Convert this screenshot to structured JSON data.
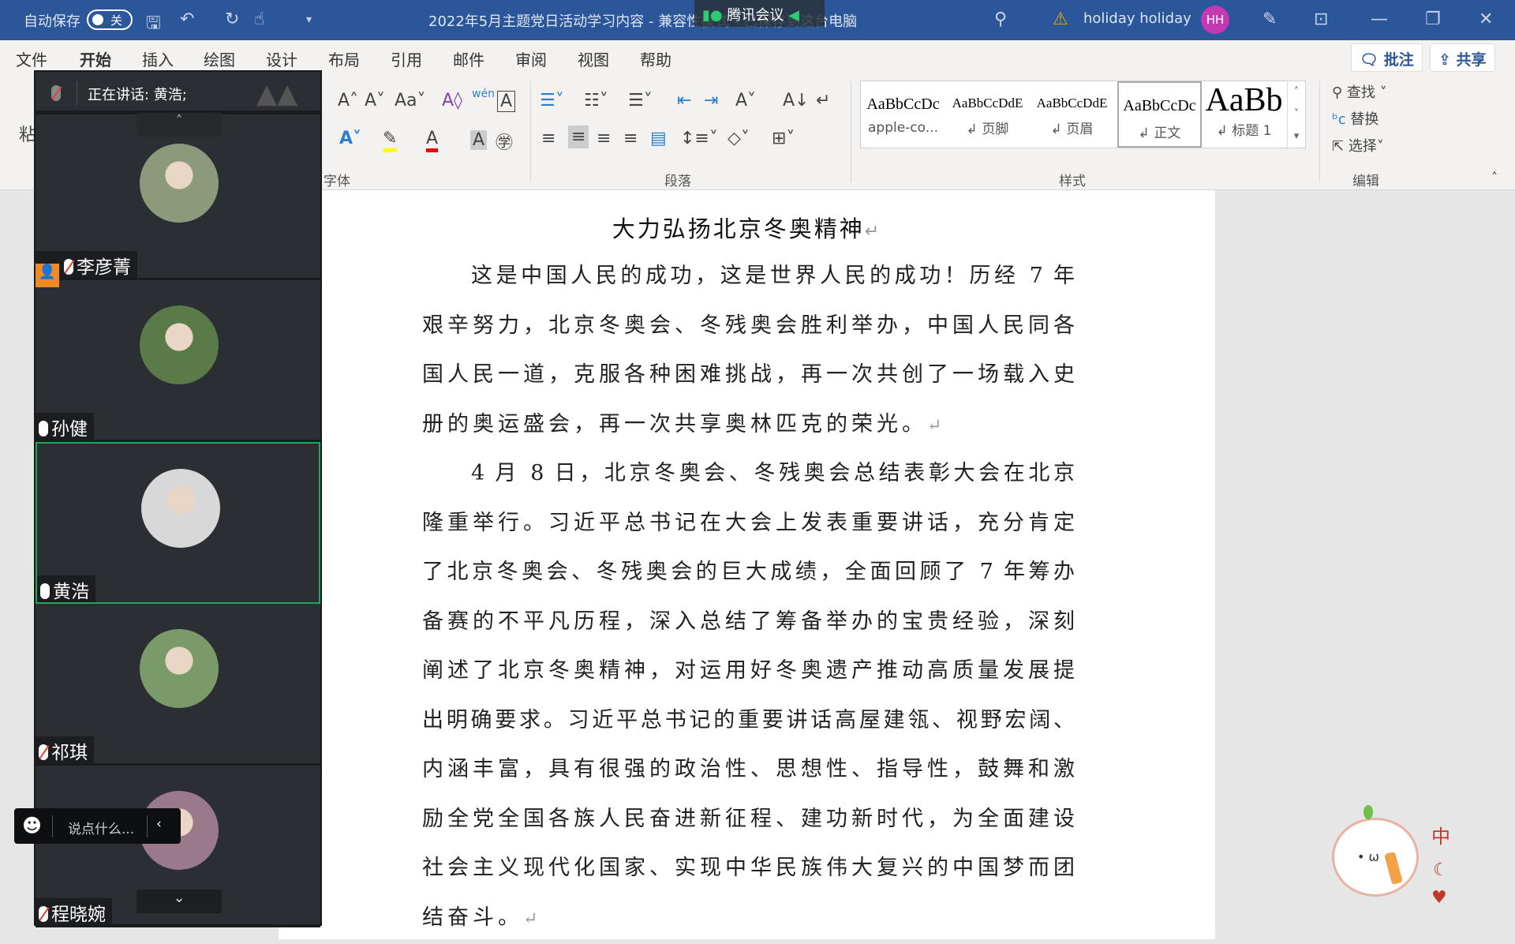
{
  "titlebar": {
    "autosave_label": "自动保存",
    "autosave_state": "关",
    "doc_title": "2022年5月主题党日活动学习内容  -  兼容性模式  -  已保存到这台电脑",
    "user_name": "holiday holiday",
    "user_initials": "HH",
    "tencent_meeting": "腾讯会议"
  },
  "menu": {
    "items": [
      "文件",
      "开始",
      "插入",
      "绘图",
      "设计",
      "布局",
      "引用",
      "邮件",
      "审阅",
      "视图",
      "帮助"
    ],
    "comment": "批注",
    "share": "共享"
  },
  "ribbon": {
    "paste": "粘",
    "font_group": "字体",
    "paragraph_group": "段落",
    "styles_group": "样式",
    "editing_group": "编辑",
    "styles": [
      {
        "sample": "AaBbCcDc",
        "label": "apple-co..."
      },
      {
        "sample": "AaBbCcDdE",
        "label": "↲ 页脚"
      },
      {
        "sample": "AaBbCcDdE",
        "label": "↲ 页眉"
      },
      {
        "sample": "AaBbCcDc",
        "label": "↲ 正文"
      },
      {
        "sample": "AaBb",
        "label": "↲ 标题 1"
      }
    ],
    "find": "查找",
    "replace": "替换",
    "select": "选择"
  },
  "document": {
    "title": "大力弘扬北京冬奥精神",
    "paragraphs": [
      [
        "这是中国人民的成功，这是世界人民的成功！历经 7 年",
        "艰辛努力，北京冬奥会、冬残奥会胜利举办，中国人民同各",
        "国人民一道，克服各种困难挑战，再一次共创了一场载入史",
        "册的奥运盛会，再一次共享奥林匹克的荣光。"
      ],
      [
        "4 月 8 日，北京冬奥会、冬残奥会总结表彰大会在北京",
        "隆重举行。习近平总书记在大会上发表重要讲话，充分肯定",
        "了北京冬奥会、冬残奥会的巨大成绩，全面回顾了 7 年筹办",
        "备赛的不平凡历程，深入总结了筹备举办的宝贵经验，深刻",
        "阐述了北京冬奥精神，对运用好冬奥遗产推动高质量发展提",
        "出明确要求。习近平总书记的重要讲话高屋建瓴、视野宏阔、",
        "内涵丰富，具有很强的政治性、思想性、指导性，鼓舞和激",
        "励全党全国各族人民奋进新征程、建功新时代，为全面建设",
        "社会主义现代化国家、实现中华民族伟大复兴的中国梦而团",
        "结奋斗。"
      ]
    ]
  },
  "meeting": {
    "speaking": "正在讲话: 黄浩;",
    "chat_placeholder": "说点什么...",
    "participants": [
      {
        "name": "李彦菁",
        "muted": true,
        "host": true
      },
      {
        "name": "孙健",
        "muted": false
      },
      {
        "name": "黄浩",
        "muted": false,
        "speaking": true
      },
      {
        "name": "祁琪",
        "muted": true
      },
      {
        "name": "程晓婉",
        "muted": true
      }
    ]
  },
  "mascot": {
    "text": "中"
  }
}
